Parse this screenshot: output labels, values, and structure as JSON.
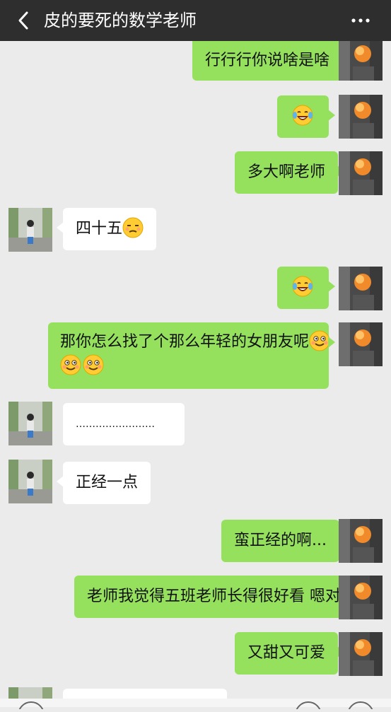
{
  "header": {
    "title": "皮的要死的数学老师",
    "back_icon": "chevron-left-icon",
    "more_icon": "more-dots-icon"
  },
  "colors": {
    "header_bg": "#2e2e2e",
    "chat_bg": "#ebebeb",
    "my_bubble": "#95e15e",
    "their_bubble": "#ffffff"
  },
  "messages": [
    {
      "sender": "me",
      "text": "行行行你说啥是啥"
    },
    {
      "sender": "me",
      "emoji": "laughing-crying-emoji"
    },
    {
      "sender": "me",
      "text": "多大啊老师"
    },
    {
      "sender": "them",
      "text": "四十五",
      "emoji": "unamused-face-emoji"
    },
    {
      "sender": "me",
      "emoji": "laughing-crying-emoji"
    },
    {
      "sender": "me",
      "line1": "那你怎么找了个那么年轻的女朋友呢",
      "emoji": "grinning-squint-emoji"
    },
    {
      "sender": "them",
      "text": "……………………"
    },
    {
      "sender": "them",
      "text": "正经一点"
    },
    {
      "sender": "me",
      "text": "蛮正经的啊..."
    },
    {
      "sender": "me",
      "text": "老师我觉得五班老师长得很好看 嗯对"
    },
    {
      "sender": "me",
      "text": "又甜又可爱"
    }
  ]
}
